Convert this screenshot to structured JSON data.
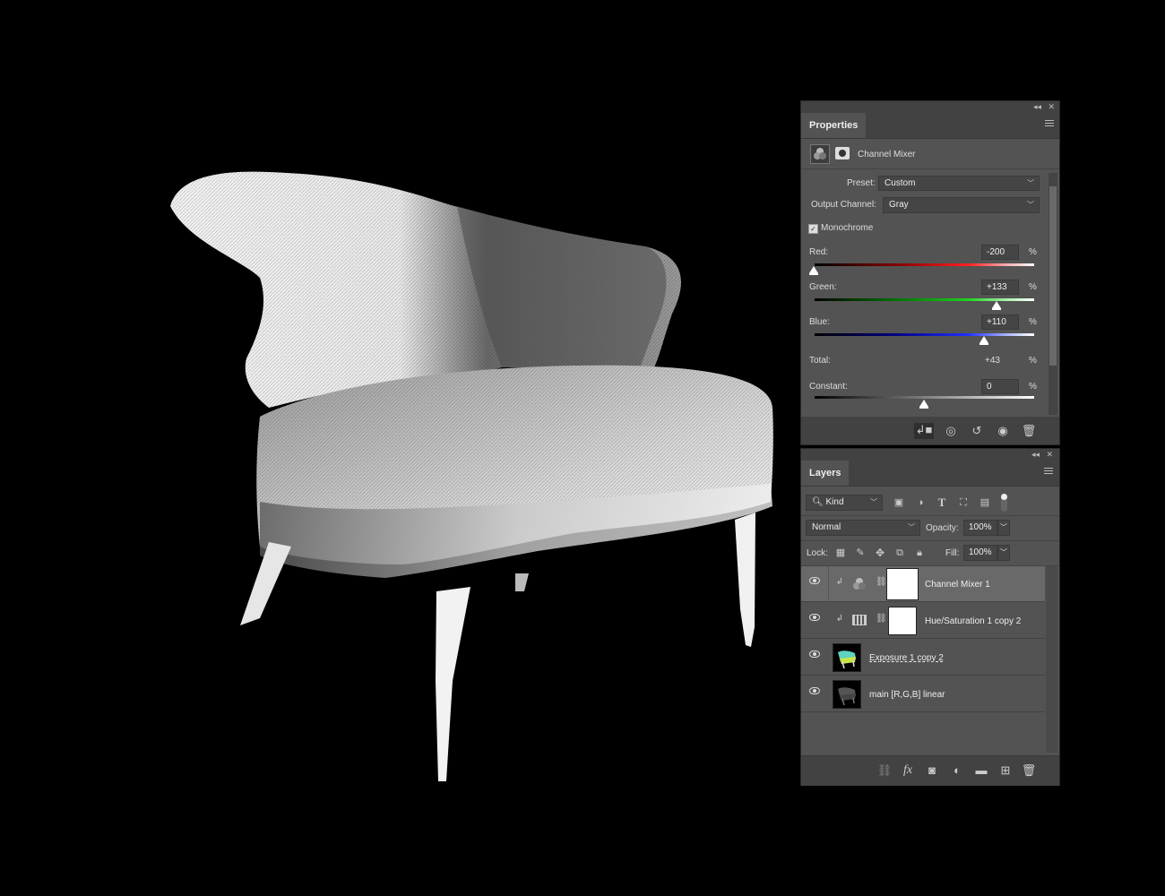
{
  "properties": {
    "tab": "Properties",
    "adjustment_name": "Channel Mixer",
    "preset_label": "Preset:",
    "preset_value": "Custom",
    "output_label": "Output Channel:",
    "output_value": "Gray",
    "monochrome_label": "Monochrome",
    "monochrome_checked": true,
    "red_label": "Red:",
    "red_value": "-200",
    "green_label": "Green:",
    "green_value": "+133",
    "blue_label": "Blue:",
    "blue_value": "+110",
    "total_label": "Total:",
    "total_value": "+43",
    "constant_label": "Constant:",
    "constant_value": "0",
    "percent": "%",
    "bottom_icons": [
      "clip-to-layer-icon",
      "view-previous-icon",
      "reset-icon",
      "visibility-icon",
      "delete-icon"
    ]
  },
  "layers": {
    "tab": "Layers",
    "filter_value": "Kind",
    "filter_icons": [
      "image-filter-icon",
      "adjustment-filter-icon",
      "type-filter-icon",
      "shape-filter-icon",
      "smart-object-filter-icon",
      "filter-toggle-icon"
    ],
    "blend_mode": "Normal",
    "opacity_label": "Opacity:",
    "opacity_value": "100%",
    "lock_label": "Lock:",
    "lock_icons": [
      "lock-transparent-icon",
      "lock-pixels-icon",
      "lock-position-icon",
      "lock-artboard-icon",
      "lock-all-icon"
    ],
    "fill_label": "Fill:",
    "fill_value": "100%",
    "items": [
      {
        "name": "Channel Mixer 1",
        "selected": true,
        "type": "adjustment",
        "icon": "channel-mixer-icon"
      },
      {
        "name": "Hue/Saturation 1 copy 2",
        "selected": false,
        "type": "adjustment",
        "icon": "hue-saturation-icon"
      },
      {
        "name": "Exposure 1 copy 2",
        "selected": false,
        "type": "pixel"
      },
      {
        "name": "main [R,G,B] linear",
        "selected": false,
        "type": "pixel"
      }
    ],
    "bottom_icons": [
      "link-layers-icon",
      "fx-icon",
      "add-mask-icon",
      "new-adjustment-icon",
      "new-group-icon",
      "new-layer-icon",
      "delete-layer-icon"
    ]
  }
}
